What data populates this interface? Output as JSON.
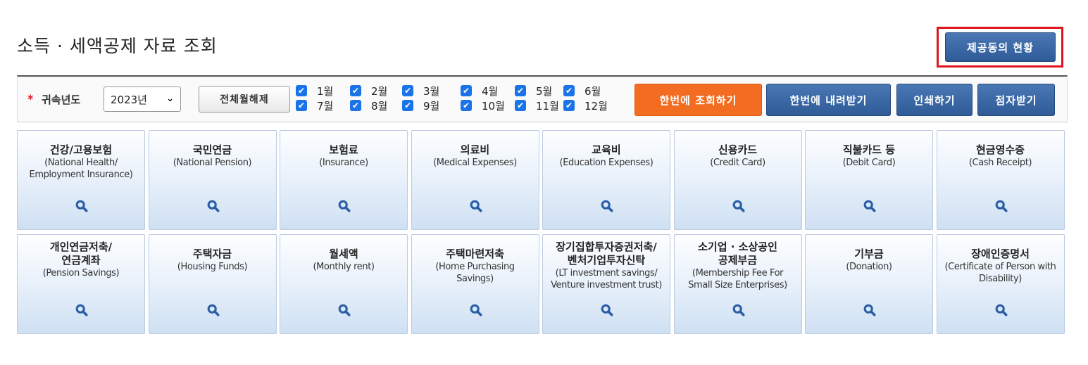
{
  "page": {
    "title": "소득 · 세액공제 자료 조회",
    "consent_button": "제공동의 현황"
  },
  "toolbar": {
    "year_label": "귀속년도",
    "year_value": "2023년",
    "clear_months_button": "전체월해제",
    "months": [
      {
        "label": "1월",
        "checked": true
      },
      {
        "label": "2월",
        "checked": true
      },
      {
        "label": "3월",
        "checked": true
      },
      {
        "label": "4월",
        "checked": true
      },
      {
        "label": "5월",
        "checked": true
      },
      {
        "label": "6월",
        "checked": true
      },
      {
        "label": "7월",
        "checked": true
      },
      {
        "label": "8월",
        "checked": true
      },
      {
        "label": "9월",
        "checked": true
      },
      {
        "label": "10월",
        "checked": true
      },
      {
        "label": "11월",
        "checked": true
      },
      {
        "label": "12월",
        "checked": true
      }
    ],
    "actions": {
      "query_all": "한번에 조회하기",
      "download_all": "한번에 내려받기",
      "print": "인쇄하기",
      "e_sign": "점자받기"
    }
  },
  "categories": [
    {
      "kr": "건강/고용보험",
      "en": "(National Health/\nEmployment Insurance)"
    },
    {
      "kr": "국민연금",
      "en": "(National Pension)"
    },
    {
      "kr": "보험료",
      "en": "(Insurance)"
    },
    {
      "kr": "의료비",
      "en": "(Medical Expenses)"
    },
    {
      "kr": "교육비",
      "en": "(Education Expenses)"
    },
    {
      "kr": "신용카드",
      "en": "(Credit Card)"
    },
    {
      "kr": "직불카드 등",
      "en": "(Debit Card)"
    },
    {
      "kr": "현금영수증",
      "en": "(Cash Receipt)"
    },
    {
      "kr": "개인연금저축/\n연금계좌",
      "en": "(Pension Savings)"
    },
    {
      "kr": "주택자금",
      "en": "(Housing Funds)"
    },
    {
      "kr": "월세액",
      "en": "(Monthly rent)"
    },
    {
      "kr": "주택마련저축",
      "en": "(Home Purchasing\nSavings)"
    },
    {
      "kr": "장기집합투자증권저축/\n벤처기업투자신탁",
      "en": "(LT investment savings/\nVenture investment trust)"
    },
    {
      "kr": "소기업 · 소상공인\n공제부금",
      "en": "(Membership Fee For\nSmall Size Enterprises)"
    },
    {
      "kr": "기부금",
      "en": "(Donation)"
    },
    {
      "kr": "장애인증명서",
      "en": "(Certificate of Person with\nDisability)"
    }
  ],
  "colors": {
    "accent_blue": "#2f5b97",
    "accent_orange": "#f26d21",
    "highlight_red": "#e0141e",
    "checkbox_blue": "#1a73e8"
  },
  "icons": {
    "tile_icon": "magnifier-icon",
    "select_icon": "chevron-down-icon",
    "checkbox_icon": "check-icon"
  }
}
